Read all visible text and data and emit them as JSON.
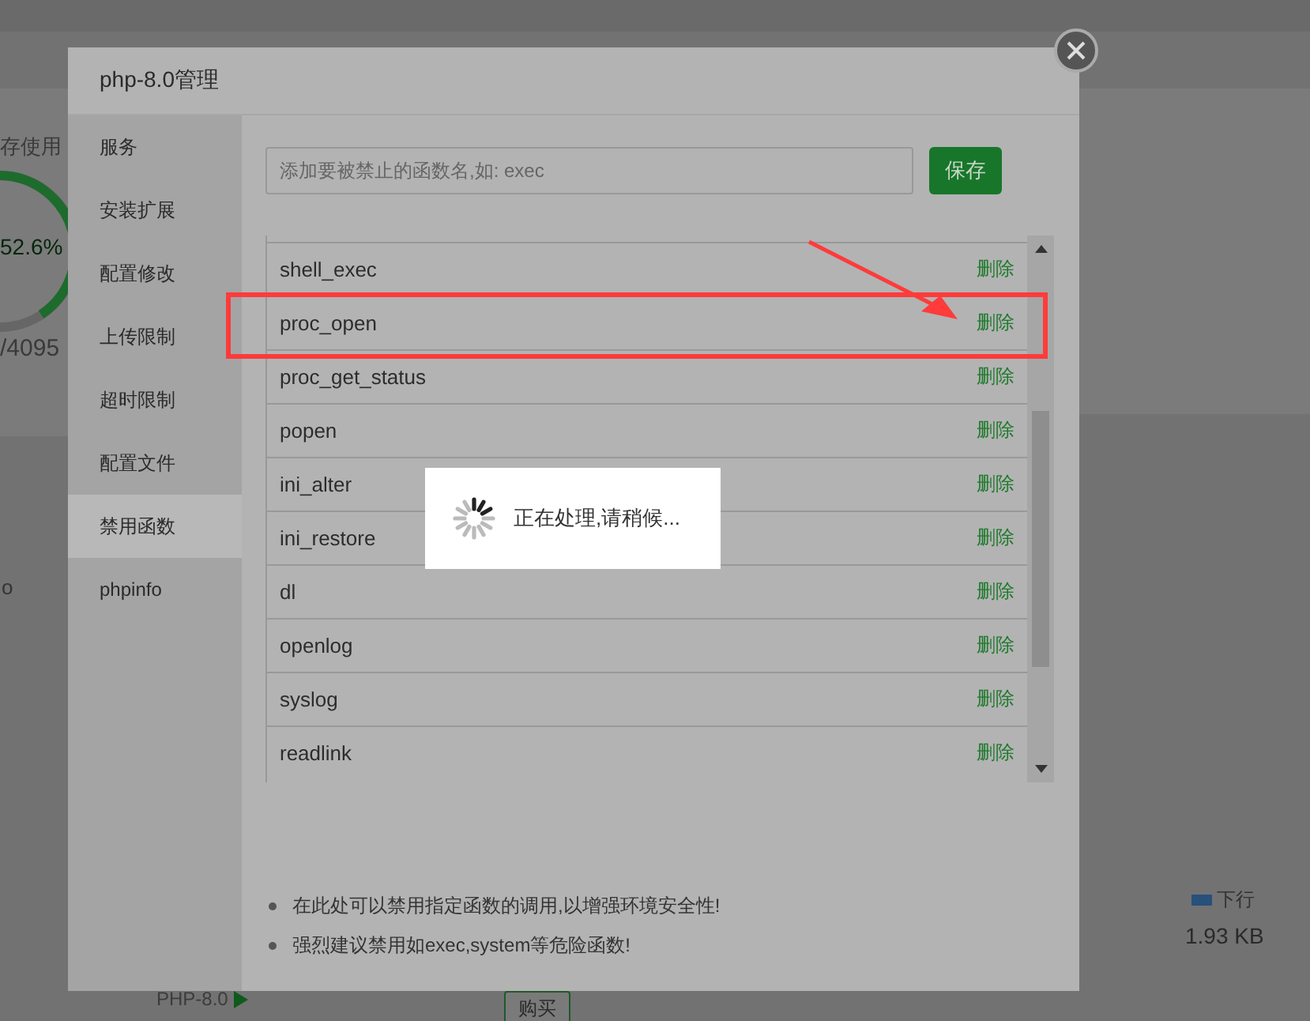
{
  "background": {
    "memory_label": "存使用",
    "memory_percent": "52.6%",
    "memory_total": "/4095",
    "side_text": "o",
    "legend": "下行",
    "download_value": "1.93 KB",
    "php_label": "PHP-8.0",
    "buy_button": "购买"
  },
  "modal": {
    "title": "php-8.0管理",
    "sidebar": [
      {
        "label": "服务",
        "selected": false
      },
      {
        "label": "安装扩展",
        "selected": false
      },
      {
        "label": "配置修改",
        "selected": false
      },
      {
        "label": "上传限制",
        "selected": false
      },
      {
        "label": "超时限制",
        "selected": false
      },
      {
        "label": "配置文件",
        "selected": false
      },
      {
        "label": "禁用函数",
        "selected": true
      },
      {
        "label": "phpinfo",
        "selected": false
      }
    ],
    "input": {
      "placeholder": "添加要被禁止的函数名,如: exec"
    },
    "save_button": "保存",
    "functions": [
      {
        "name": "shell_exec",
        "action": "删除",
        "highlighted": false
      },
      {
        "name": "proc_open",
        "action": "删除",
        "highlighted": true
      },
      {
        "name": "proc_get_status",
        "action": "删除",
        "highlighted": false
      },
      {
        "name": "popen",
        "action": "删除",
        "highlighted": false
      },
      {
        "name": "ini_alter",
        "action": "删除",
        "highlighted": false
      },
      {
        "name": "ini_restore",
        "action": "删除",
        "highlighted": false
      },
      {
        "name": "dl",
        "action": "删除",
        "highlighted": false
      },
      {
        "name": "openlog",
        "action": "删除",
        "highlighted": false
      },
      {
        "name": "syslog",
        "action": "删除",
        "highlighted": false
      },
      {
        "name": "readlink",
        "action": "删除",
        "highlighted": false
      }
    ],
    "notes": [
      "在此处可以禁用指定函数的调用,以增强环境安全性!",
      "强烈建议禁用如exec,system等危险函数!"
    ]
  },
  "loading": {
    "message": "正在处理,请稍候..."
  }
}
